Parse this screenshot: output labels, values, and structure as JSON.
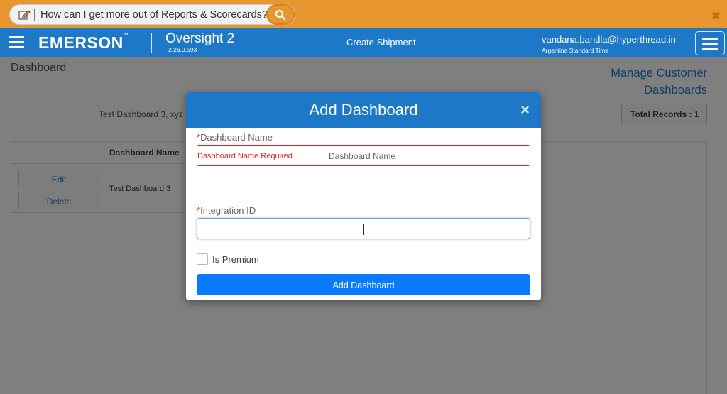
{
  "helpbar": {
    "question": "How can I get more out of Reports & Scorecards?",
    "icons": {
      "edit": "edit-icon",
      "search": "search-icon",
      "close": "close-icon"
    }
  },
  "navbar": {
    "brand": "EMERSON",
    "brand_tm": "™",
    "app_name": "Oversight 2",
    "version": "2.26.0.593",
    "center_link": "Create Shipment",
    "user_email": "vandana.bandla@hyperthread.in",
    "timezone": "Argentina Standard Time"
  },
  "page": {
    "title": "Dashboard",
    "manage_link_line1": "Manage Customer",
    "manage_link_line2": "Dashboards",
    "filter_value": "Test Dashboard 3, xyz",
    "total_label": "Total Records :",
    "total_value": "1",
    "grid": {
      "column_header": "Dashboard Name",
      "rows": [
        {
          "name": "Test Dashboard 3",
          "edit": "Edit",
          "delete": "Delete"
        }
      ]
    }
  },
  "modal": {
    "title": "Add Dashboard",
    "close_symbol": "×",
    "required_mark": "*",
    "dashboard_name_label": "Dashboard Name",
    "dashboard_name_error": "Dashboard Name Required",
    "dashboard_name_placeholder": "Dashboard Name",
    "integration_id_label": "Integration ID",
    "integration_id_value": "",
    "premium_label": "Is Premium",
    "premium_checked": false,
    "submit_label": "Add Dashboard"
  },
  "colors": {
    "helpbar": "#e8962e",
    "navbar": "#1d78c8",
    "error": "#e02020",
    "primary_button": "#0a7bff"
  }
}
